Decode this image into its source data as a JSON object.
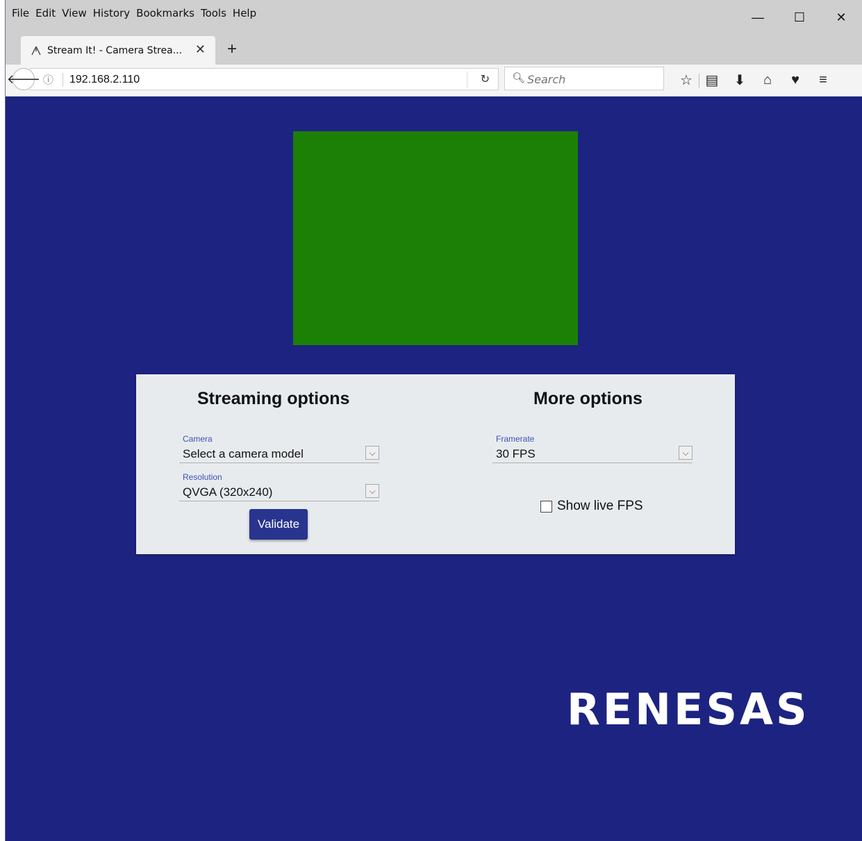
{
  "menu": [
    "File",
    "Edit",
    "View",
    "History",
    "Bookmarks",
    "Tools",
    "Help"
  ],
  "window_controls": {
    "minimize": "—",
    "maximize": "☐",
    "close": "✕"
  },
  "tab": {
    "title": "Stream It! - Camera Strea...",
    "close": "✕",
    "icon": "renesas-icon"
  },
  "newtab": "+",
  "url": "192.168.2.110",
  "search": {
    "placeholder": "Search"
  },
  "page": {
    "streaming_title": "Streaming options",
    "more_title": "More options",
    "camera": {
      "label": "Camera",
      "value": "Select a camera model"
    },
    "resolution": {
      "label": "Resolution",
      "value": "QVGA (320x240)"
    },
    "framerate": {
      "label": "Framerate",
      "value": "30 FPS"
    },
    "validate_label": "Validate",
    "show_fps_label": "Show live FPS",
    "show_fps_checked": false,
    "logo": "RENESAS"
  },
  "colors": {
    "background": "#1c2381",
    "video": "#1c8006",
    "panel": "#e8ebee",
    "button": "#28348e"
  }
}
